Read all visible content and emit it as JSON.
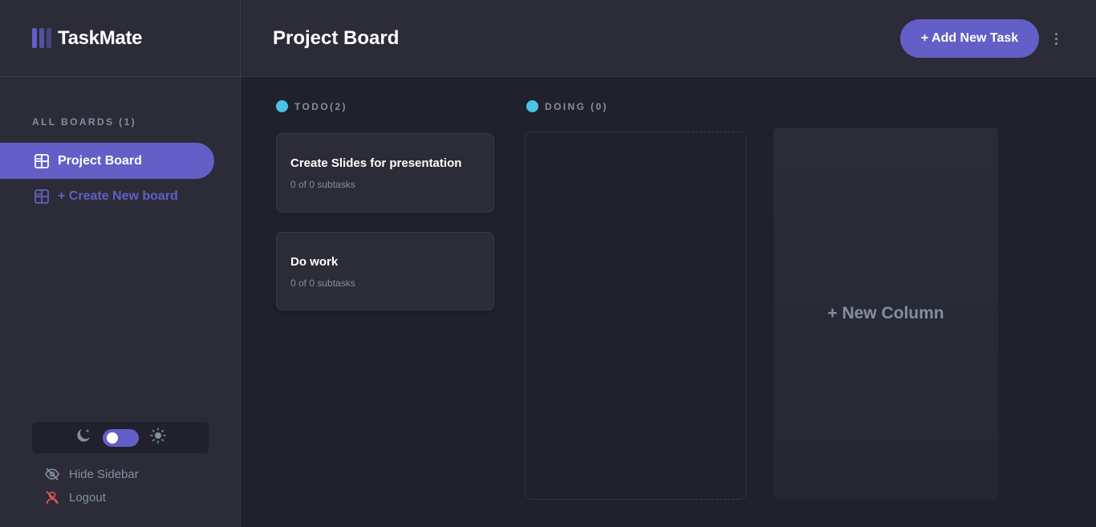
{
  "app": {
    "name": "TaskMate",
    "accent_color": "#635fc7"
  },
  "sidebar": {
    "boards_heading": "ALL BOARDS (1)",
    "boards": [
      {
        "label": "Project Board",
        "icon": "board-icon",
        "active": true
      }
    ],
    "create_board_label": "+ Create New board",
    "theme": {
      "dark_icon": "moon-icon",
      "light_icon": "sun-icon",
      "mode": "dark"
    },
    "hide_sidebar_label": "Hide Sidebar",
    "logout_label": "Logout"
  },
  "header": {
    "title": "Project Board",
    "add_task_label": "+ Add New Task",
    "menu_icon": "vertical-ellipsis-icon"
  },
  "columns": [
    {
      "heading": "TODO(2)",
      "dot_color": "#49c4e5",
      "tasks": [
        {
          "title": "Create Slides for presentation",
          "subtasks": "0 of 0 subtasks"
        },
        {
          "title": "Do work",
          "subtasks": "0 of 0 subtasks"
        }
      ]
    },
    {
      "heading": "DOING (0)",
      "dot_color": "#49c4e5",
      "tasks": []
    }
  ],
  "new_column_label": "+ New Column"
}
